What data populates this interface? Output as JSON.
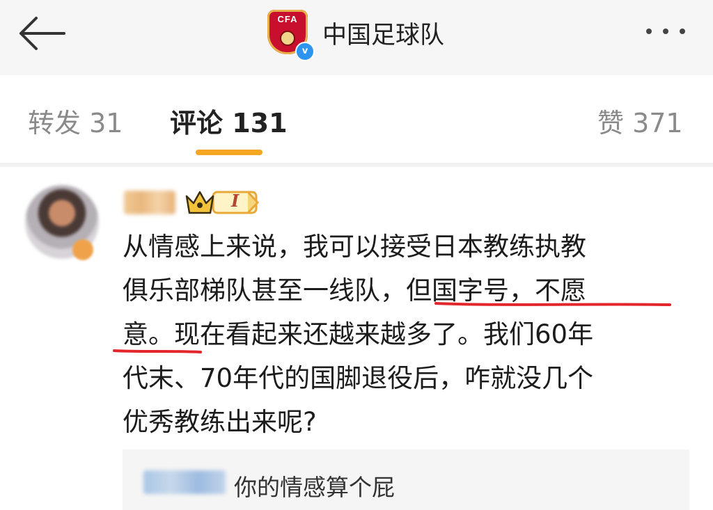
{
  "header": {
    "account_name": "中国足球队",
    "logo_text": "CFA",
    "verified_glyph": "v",
    "icons": {
      "back": "back-arrow-icon",
      "more": "more-icon"
    }
  },
  "tabs": {
    "repost": "转发 31",
    "comments": "评论 131",
    "likes": "赞 371",
    "active": "comments"
  },
  "comment": {
    "level_badge": "I",
    "lines": [
      "从情感上来说，我可以接受日本教练执教",
      "俱乐部梯队甚至一线队，但国字号，不愿",
      "意。现在看起来还越来越多了。我们60年",
      "代末、70年代的国脚退役后，咋就没几个",
      "优秀教练出来呢?"
    ]
  },
  "reply": {
    "text": "你的情感算个屁"
  },
  "colors": {
    "accent": "#f5a623",
    "underline": "#e3262b",
    "verified": "#2d95f0"
  }
}
